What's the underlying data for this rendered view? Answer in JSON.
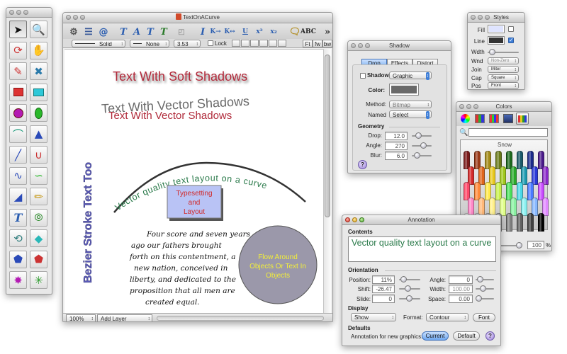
{
  "tools_window": {
    "tools": [
      {
        "name": "arrow-select-tool",
        "icon": "arrow-pointer-icon",
        "selected": true
      },
      {
        "name": "zoom-tool",
        "icon": "magnifier-ruler-icon"
      },
      {
        "name": "rotate-tool",
        "icon": "rotate-icon"
      },
      {
        "name": "hand-tool",
        "icon": "hand-icon"
      },
      {
        "name": "eyedropper-tool",
        "icon": "eyedropper-icon"
      },
      {
        "name": "brush-tool",
        "icon": "paintbrush-icon"
      },
      {
        "name": "rectangle-tool",
        "icon": "rectangle-icon"
      },
      {
        "name": "cyan-rectangle-tool",
        "icon": "cyan-rectangle-icon"
      },
      {
        "name": "circle-tool",
        "icon": "circle-icon"
      },
      {
        "name": "ellipse-tool",
        "icon": "ellipse-icon"
      },
      {
        "name": "arc-tool",
        "icon": "arc-icon"
      },
      {
        "name": "triangle-tool",
        "icon": "triangle-icon"
      },
      {
        "name": "line-tool",
        "icon": "line-icon"
      },
      {
        "name": "curve-tool",
        "icon": "curve-icon"
      },
      {
        "name": "bezier-tool",
        "icon": "bezier-icon"
      },
      {
        "name": "spiral-curve-tool",
        "icon": "spiral-curve-icon"
      },
      {
        "name": "shape-tool",
        "icon": "shape-icon"
      },
      {
        "name": "pencil-tool",
        "icon": "pencil-icon"
      },
      {
        "name": "text-tool",
        "icon": "text-t-icon"
      },
      {
        "name": "spiral-tool",
        "icon": "spiral-icon"
      },
      {
        "name": "rotate-shape-tool",
        "icon": "rotate-shape-icon"
      },
      {
        "name": "gem-tool",
        "icon": "gem-icon"
      },
      {
        "name": "pentagon-tool",
        "icon": "pentagon-icon"
      },
      {
        "name": "polygon-tool",
        "icon": "polygon-icon"
      },
      {
        "name": "star-tool",
        "icon": "star-burst-icon"
      },
      {
        "name": "starburst-tool",
        "icon": "asterisk-icon"
      }
    ]
  },
  "main_window": {
    "title": "TextOnACurve",
    "toolbar_icons": [
      "gear-icon",
      "layers-icon",
      "at-sign-icon",
      "text-t-icon",
      "text-a-icon",
      "text-t-small-icon",
      "text-color-icon",
      "text-path-icon",
      "italic-icon",
      "kern-less-icon",
      "kern-more-icon",
      "underline-icon",
      "superscript-icon",
      "subscript-icon",
      "comment-icon",
      "spellcheck-icon",
      "overflow-chevron-icon"
    ],
    "stroke_style": "Solid",
    "arrow_style": "None",
    "line_width": "3.53",
    "lock_label": "Lock",
    "text_align_buttons": [
      "Ft",
      "fw",
      "bw"
    ],
    "zoom": "100%",
    "layer_popup": "Add Layer",
    "canvas": {
      "soft_shadow_text": "Text With Soft Shadows",
      "vector_shadow_text_1": "Text With Vector Shadows",
      "vector_shadow_text_2": "Text With Vector Shadows",
      "curve_text": "Vector quality text layout on a curve",
      "bezier_text": "Bezier Stroke Text Too",
      "box_line_1": "Typesetting",
      "box_line_2": "and",
      "box_line_3": "Layout",
      "poem_lines": [
        "Four score and seven years",
        "ago our fathers brought",
        "forth on this contentment, a",
        "new nation, conceived in",
        "liberty, and dedicated to the",
        "proposition that all men are",
        "created equal."
      ],
      "circle_line_1": "Flow Around",
      "circle_line_2": "Objects Or Text In",
      "circle_line_3": "Objects"
    }
  },
  "shadow_window": {
    "title": "Shadow",
    "tabs": [
      "Drop",
      "Effects",
      "Distort"
    ],
    "shadow_checkbox_label": "Shadow",
    "shadow_type": "Graphic",
    "color_label": "Color:",
    "method_label": "Method:",
    "method_value": "Bitmap",
    "named_label": "Named",
    "named_value": "Select",
    "geometry_label": "Geometry",
    "drop_label": "Drop:",
    "drop_value": "12.0",
    "angle_label": "Angle:",
    "angle_value": "270",
    "blur_label": "Blur:",
    "blur_value": "6.0"
  },
  "styles_window": {
    "title": "Styles",
    "fill_label": "Fill",
    "line_label": "Line",
    "width_label": "Wdth",
    "wind_label": "Wnd",
    "wind_value": "Non-Zero",
    "join_label": "Join",
    "join_value": "Miter",
    "cap_label": "Cap",
    "cap_value": "Square",
    "pos_label": "Pos",
    "pos_value": "Front"
  },
  "colors_window": {
    "title": "Colors",
    "tab_icons": [
      "color-wheel-icon",
      "color-sliders-icon",
      "color-palette-icon",
      "image-palette-icon",
      "crayons-icon"
    ],
    "palette_name": "Snow",
    "opacity_value": "100",
    "percent_sign": "%",
    "crayon_colors": {
      "row1": [
        "#7a1a1a",
        "#9a3a18",
        "#a38a18",
        "#6a7a18",
        "#1e6a1e",
        "#1a5a6a",
        "#1a2a8a",
        "#4a1a8a"
      ],
      "row2": [
        "#d42a2a",
        "#e0661c",
        "#e8c81c",
        "#a0c81c",
        "#2aa82a",
        "#1c9ab0",
        "#2a3ad8",
        "#8a2ac8"
      ],
      "row3": [
        "#ff4a6a",
        "#ff8a3a",
        "#ffe84a",
        "#c8f04a",
        "#4ae05a",
        "#4ad8e8",
        "#4a7aff",
        "#c84aff"
      ],
      "row4": [
        "#ff88c8",
        "#ffb878",
        "#fff088",
        "#e0ff88",
        "#88f0a0",
        "#88f0f0",
        "#88b8ff",
        "#e088ff"
      ],
      "row5": [
        "#ffffff",
        "#e0e0e0",
        "#c0c0c0",
        "#a0a0a0",
        "#808080",
        "#606060",
        "#404040",
        "#000000"
      ]
    }
  },
  "annotation_window": {
    "title": "Annotation",
    "contents_label": "Contents",
    "contents_text": "Vector quality text layout on a curve",
    "orientation_label": "Orientation",
    "position_label": "Position:",
    "position_value": "11%",
    "shift_label": "Shift:",
    "shift_value": "-26.47",
    "slide_label": "Slide:",
    "slide_value": "0",
    "angle_label": "Angle:",
    "angle_value": "0",
    "width_label": "Width:",
    "width_value": "100.00",
    "space_label": "Space:",
    "space_value": "0.00",
    "display_label": "Display",
    "display_value": "Show",
    "format_label": "Format:",
    "format_value": "Contour",
    "font_button": "Font",
    "defaults_label": "Defaults",
    "defaults_text": "Annotation for new graphics:",
    "current_button": "Current",
    "default_button": "Default",
    "help": "?"
  },
  "help_glyph": "?"
}
